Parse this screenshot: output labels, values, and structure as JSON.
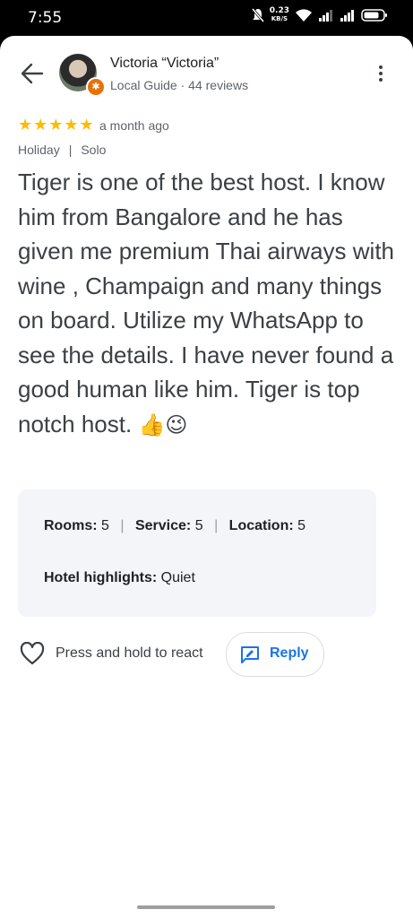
{
  "status_bar": {
    "time": "7:55",
    "net_speed_value": "0.23",
    "net_speed_unit": "KB/S",
    "icons": [
      "mute-bell-icon",
      "wifi-icon",
      "signal-icon",
      "signal-icon",
      "battery-icon"
    ]
  },
  "header": {
    "back_icon": "arrow-back-icon",
    "reviewer_name": "Victoria “Victoria”",
    "reviewer_sub": "Local Guide · 44 reviews",
    "more_icon": "more-vert-icon"
  },
  "review": {
    "stars": "★★★★★",
    "rating": 5,
    "time_ago": "a month ago",
    "trip_type": "Holiday",
    "travel_group": "Solo",
    "text": "Tiger is one of the best host. I know him from Bangalore and he has given me premium Thai airways with wine , Champaign and many things on board. Utilize my WhatsApp to see the details. I have never found a good human like him. Tiger is top notch host.",
    "emojis": "👍😉"
  },
  "ratings": {
    "rooms_label": "Rooms:",
    "rooms_value": "5",
    "service_label": "Service:",
    "service_value": "5",
    "location_label": "Location:",
    "location_value": "5",
    "highlights_label": "Hotel highlights:",
    "highlights_value": "Quiet"
  },
  "actions": {
    "react_label": "Press and hold to react",
    "reply_label": "Reply"
  },
  "colors": {
    "star": "#fbbc04",
    "accent": "#1a73e8",
    "guide_badge": "#e8710a",
    "ratings_bg": "#f3f5f8"
  }
}
